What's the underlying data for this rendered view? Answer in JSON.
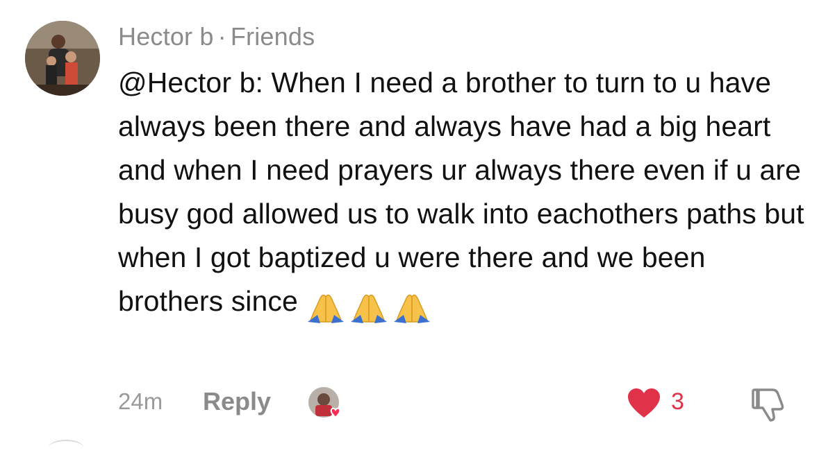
{
  "comment": {
    "author": "Hector b",
    "separator": "·",
    "relationship": "Friends",
    "text": "@Hector b: When I need a brother to turn to u have always been there and always have had a big heart and when I need prayers ur always there even if u are busy god allowed us to walk into eachothers paths but when I got baptized u were there and we been brothers since",
    "emojis": [
      "folded-hands-icon",
      "folded-hands-icon",
      "folded-hands-icon"
    ],
    "timestamp": "24m",
    "reply_label": "Reply",
    "like_count": "3",
    "liked": true
  },
  "colors": {
    "like_red": "#e0334a",
    "muted_gray": "#8a8a8a",
    "text": "#111111"
  }
}
